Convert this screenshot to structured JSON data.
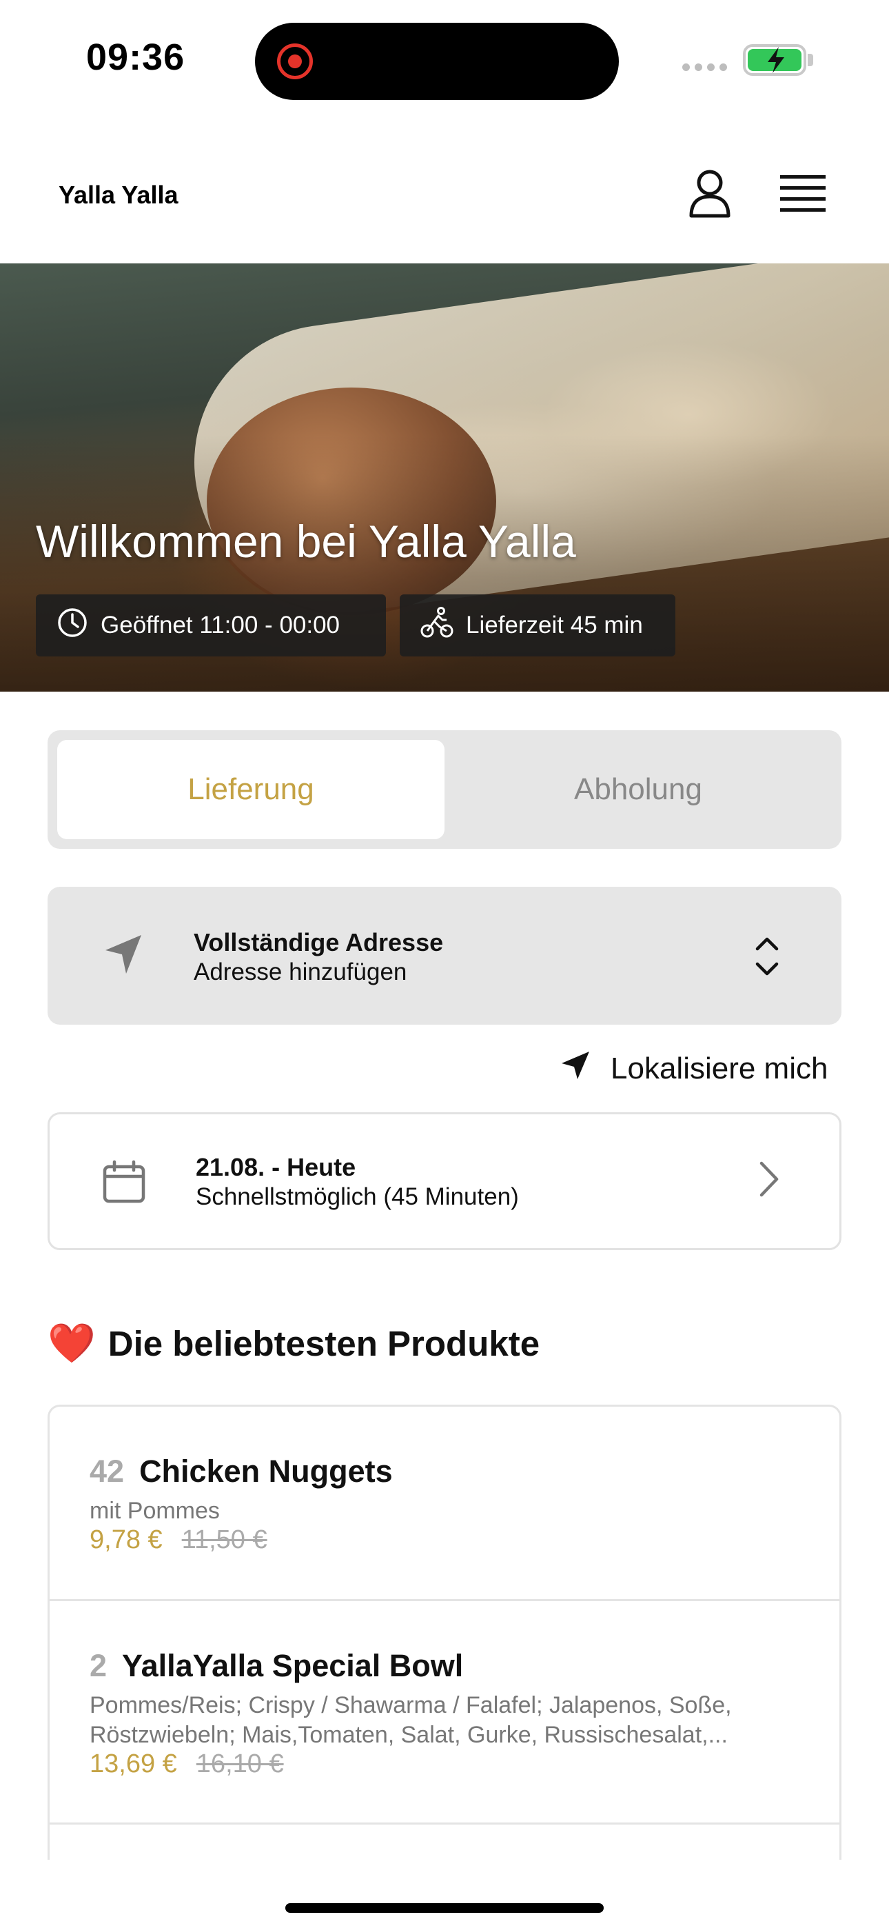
{
  "status_bar": {
    "time": "09:36"
  },
  "header": {
    "brand": "Yalla Yalla"
  },
  "hero": {
    "title": "Willkommen bei Yalla Yalla",
    "opening_hours": "Geöffnet 11:00 - 00:00",
    "delivery_time": "Lieferzeit 45 min"
  },
  "order_mode": {
    "options": [
      "Lieferung",
      "Abholung"
    ],
    "selected": "Lieferung"
  },
  "address": {
    "title": "Vollständige Adresse",
    "subtitle": "Adresse hinzufügen",
    "locate_label": "Lokalisiere mich"
  },
  "schedule": {
    "date": "21.08. - Heute",
    "time": "Schnellstmöglich (45 Minuten)"
  },
  "popular": {
    "emoji": "❤️",
    "title": "Die beliebtesten Produkte",
    "products": [
      {
        "number": "42",
        "name": "Chicken Nuggets",
        "description": "mit Pommes",
        "price": "9,78 €",
        "old_price": "11,50 €"
      },
      {
        "number": "2",
        "name": "YallaYalla Special Bowl",
        "description": "Pommes/Reis; Crispy / Shawarma / Falafel; Jalapenos, Soße, Röstzwiebeln; Mais,Tomaten, Salat, Gurke, Russischesalat,...",
        "price": "13,69 €",
        "old_price": "16,10 €"
      }
    ]
  },
  "colors": {
    "accent": "#c4a244",
    "segment_bg": "#e6e6e6",
    "battery": "#33c759",
    "record": "#e5332a"
  }
}
